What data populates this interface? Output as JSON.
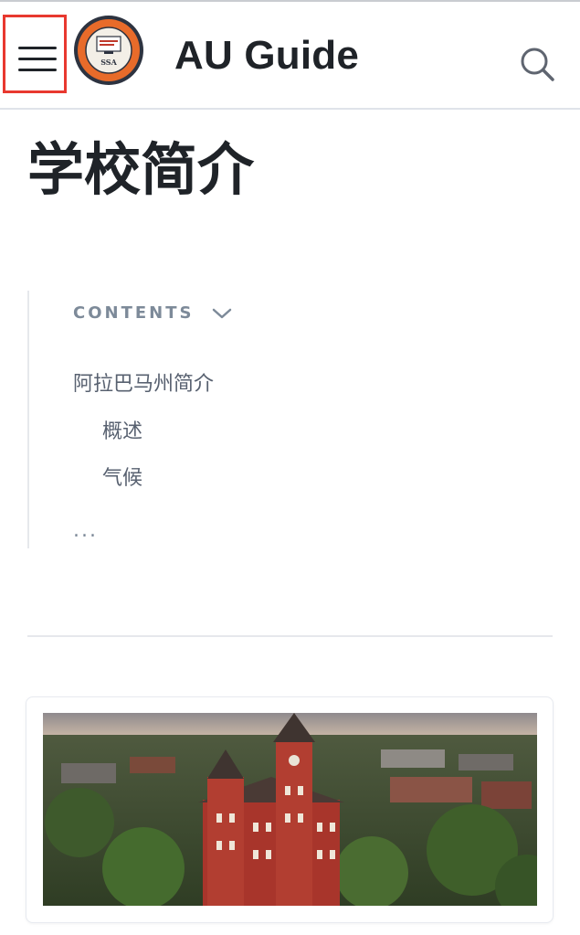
{
  "header": {
    "site_title": "AU Guide",
    "logo_text": "SSA",
    "menu_icon": "hamburger-menu-icon",
    "search_icon": "search-icon"
  },
  "page": {
    "title": "学校简介"
  },
  "toc": {
    "heading": "CONTENTS",
    "items": [
      {
        "label": "阿拉巴马州简介",
        "level": 1
      },
      {
        "label": "概述",
        "level": 2
      },
      {
        "label": "气候",
        "level": 2
      }
    ],
    "more": "..."
  },
  "colors": {
    "highlight": "#e8382f",
    "toc_heading": "#7d8a99",
    "text": "#1f2328",
    "brick": "#a8352b"
  }
}
